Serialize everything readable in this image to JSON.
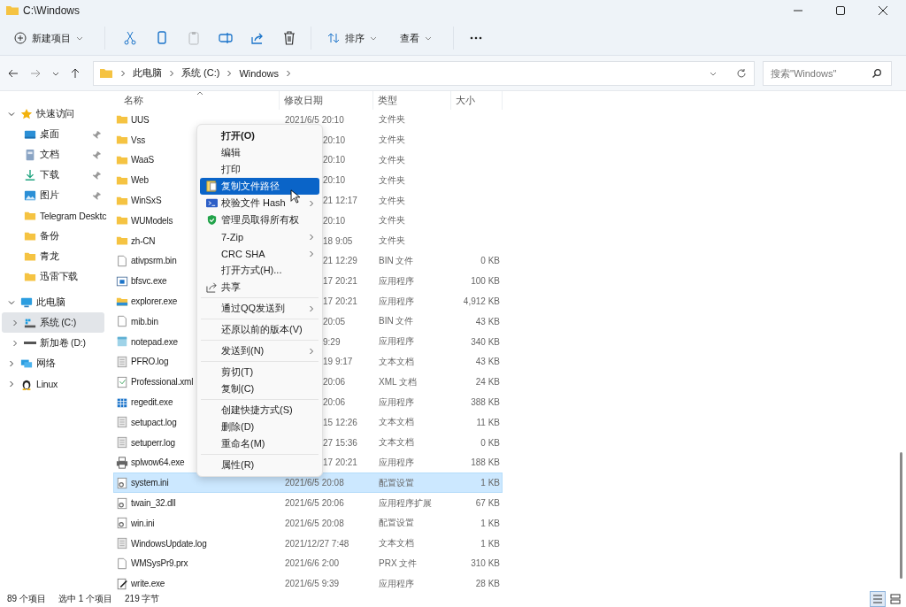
{
  "window": {
    "title": "C:\\Windows"
  },
  "toolbar": {
    "new_item": "新建项目",
    "buttons": [
      {
        "kind": "cut",
        "disabled": false
      },
      {
        "kind": "copy",
        "disabled": false
      },
      {
        "kind": "paste",
        "disabled": true
      },
      {
        "kind": "rename",
        "disabled": false
      },
      {
        "kind": "share",
        "disabled": false
      },
      {
        "kind": "delete",
        "disabled": false
      }
    ],
    "sort": "排序",
    "view": "查看"
  },
  "address": {
    "crumbs": [
      "此电脑",
      "系统 (C:)",
      "Windows"
    ],
    "search_placeholder": "搜索\"Windows\""
  },
  "nav": [
    {
      "label": "快速访问",
      "kind": "star",
      "expanded": true,
      "selected": false,
      "children": [
        {
          "label": "桌面",
          "kind": "desktop",
          "pinned": true,
          "selected": false
        },
        {
          "label": "文档",
          "kind": "documents",
          "pinned": true,
          "selected": false
        },
        {
          "label": "下载",
          "kind": "download",
          "pinned": true,
          "selected": false
        },
        {
          "label": "图片",
          "kind": "pictures",
          "pinned": true,
          "selected": false
        },
        {
          "label": "Telegram Desktc",
          "kind": "folder",
          "pinned": false,
          "selected": false
        },
        {
          "label": "备份",
          "kind": "folder",
          "pinned": false,
          "selected": false
        },
        {
          "label": "青龙",
          "kind": "folder",
          "pinned": false,
          "selected": false
        },
        {
          "label": "迅雷下载",
          "kind": "folder",
          "pinned": false,
          "selected": false
        }
      ]
    },
    {
      "label": "此电脑",
      "kind": "pc",
      "expanded": true,
      "selected": false,
      "children": [
        {
          "label": "系统 (C:)",
          "kind": "drive-c",
          "expandable": true,
          "pinned": false,
          "selected": true
        },
        {
          "label": "新加卷 (D:)",
          "kind": "drive",
          "expandable": true,
          "pinned": false,
          "selected": false
        }
      ]
    },
    {
      "label": "网络",
      "kind": "network",
      "expanded": false,
      "selected": false
    },
    {
      "label": "Linux",
      "kind": "linux",
      "expanded": false,
      "selected": false
    }
  ],
  "table": {
    "columns": [
      "名称",
      "修改日期",
      "类型",
      "大小"
    ],
    "rows": [
      {
        "kind": "folder",
        "name": "UUS",
        "date": "2021/6/5 20:10",
        "date_clipped": false,
        "type": "文件夹",
        "size": "",
        "selected": false
      },
      {
        "kind": "folder",
        "name": "Vss",
        "date": "20:10",
        "date_clipped": true,
        "type": "文件夹",
        "size": "",
        "selected": false
      },
      {
        "kind": "folder",
        "name": "WaaS",
        "date": "20:10",
        "date_clipped": true,
        "type": "文件夹",
        "size": "",
        "selected": false
      },
      {
        "kind": "folder",
        "name": "Web",
        "date": "20:10",
        "date_clipped": true,
        "type": "文件夹",
        "size": "",
        "selected": false
      },
      {
        "kind": "folder",
        "name": "WinSxS",
        "date": "21 12:17",
        "date_clipped": true,
        "type": "文件夹",
        "size": "",
        "selected": false
      },
      {
        "kind": "folder",
        "name": "WUModels",
        "date": "20:10",
        "date_clipped": true,
        "type": "文件夹",
        "size": "",
        "selected": false
      },
      {
        "kind": "folder",
        "name": "zh-CN",
        "date": "18 9:05",
        "date_clipped": true,
        "type": "文件夹",
        "size": "",
        "selected": false
      },
      {
        "kind": "doc",
        "name": "ativpsrm.bin",
        "date": "21 12:29",
        "date_clipped": true,
        "type": "BIN 文件",
        "size": "0 KB",
        "selected": false
      },
      {
        "kind": "app",
        "name": "bfsvc.exe",
        "date": "17 20:21",
        "date_clipped": true,
        "type": "应用程序",
        "size": "100 KB",
        "selected": false
      },
      {
        "kind": "explorer",
        "name": "explorer.exe",
        "date": "17 20:21",
        "date_clipped": true,
        "type": "应用程序",
        "size": "4,912 KB",
        "selected": false
      },
      {
        "kind": "doc",
        "name": "mib.bin",
        "date": "20:05",
        "date_clipped": true,
        "type": "BIN 文件",
        "size": "43 KB",
        "selected": false
      },
      {
        "kind": "notepad",
        "name": "notepad.exe",
        "date": "9:29",
        "date_clipped": true,
        "type": "应用程序",
        "size": "340 KB",
        "selected": false
      },
      {
        "kind": "text",
        "name": "PFRO.log",
        "date": "19 9:17",
        "date_clipped": true,
        "type": "文本文档",
        "size": "43 KB",
        "selected": false
      },
      {
        "kind": "xml",
        "name": "Professional.xml",
        "date": "20:06",
        "date_clipped": true,
        "type": "XML 文档",
        "size": "24 KB",
        "selected": false
      },
      {
        "kind": "regedit",
        "name": "regedit.exe",
        "date": "20:06",
        "date_clipped": true,
        "type": "应用程序",
        "size": "388 KB",
        "selected": false
      },
      {
        "kind": "text",
        "name": "setupact.log",
        "date": "15 12:26",
        "date_clipped": true,
        "type": "文本文档",
        "size": "11 KB",
        "selected": false
      },
      {
        "kind": "text",
        "name": "setuperr.log",
        "date": "27 15:36",
        "date_clipped": true,
        "type": "文本文档",
        "size": "0 KB",
        "selected": false
      },
      {
        "kind": "printer",
        "name": "splwow64.exe",
        "date": "17 20:21",
        "date_clipped": true,
        "type": "应用程序",
        "size": "188 KB",
        "selected": false
      },
      {
        "kind": "gear",
        "name": "system.ini",
        "date": "2021/6/5 20:08",
        "date_clipped": false,
        "type": "配置设置",
        "size": "1 KB",
        "selected": true
      },
      {
        "kind": "gear",
        "name": "twain_32.dll",
        "date": "2021/6/5 20:06",
        "date_clipped": false,
        "type": "应用程序扩展",
        "size": "67 KB",
        "selected": false
      },
      {
        "kind": "gear",
        "name": "win.ini",
        "date": "2021/6/5 20:08",
        "date_clipped": false,
        "type": "配置设置",
        "size": "1 KB",
        "selected": false
      },
      {
        "kind": "text",
        "name": "WindowsUpdate.log",
        "date": "2021/12/27 7:48",
        "date_clipped": false,
        "type": "文本文档",
        "size": "1 KB",
        "selected": false
      },
      {
        "kind": "doc",
        "name": "WMSysPr9.prx",
        "date": "2021/6/6 2:00",
        "date_clipped": false,
        "type": "PRX 文件",
        "size": "310 KB",
        "selected": false
      },
      {
        "kind": "write",
        "name": "write.exe",
        "date": "2021/6/5 9:39",
        "date_clipped": false,
        "type": "应用程序",
        "size": "28 KB",
        "selected": false
      }
    ]
  },
  "context_menu": [
    {
      "kind": "text",
      "label": "打开(O)",
      "bold": true,
      "selected": false,
      "submenu": false
    },
    {
      "kind": "text",
      "label": "编辑",
      "bold": false,
      "selected": false,
      "submenu": false
    },
    {
      "kind": "text",
      "label": "打印",
      "bold": false,
      "selected": false,
      "submenu": false
    },
    {
      "kind": "copy-path",
      "label": "复制文件路径",
      "bold": false,
      "selected": true,
      "submenu": false
    },
    {
      "kind": "hash",
      "label": "校验文件 Hash",
      "bold": false,
      "selected": false,
      "submenu": true
    },
    {
      "kind": "shield",
      "label": "管理员取得所有权",
      "bold": false,
      "selected": false,
      "submenu": false
    },
    {
      "kind": "text",
      "label": "7-Zip",
      "bold": false,
      "selected": false,
      "submenu": true
    },
    {
      "kind": "text",
      "label": "CRC SHA",
      "bold": false,
      "selected": false,
      "submenu": true
    },
    {
      "kind": "text",
      "label": "打开方式(H)...",
      "bold": false,
      "selected": false,
      "submenu": false
    },
    {
      "kind": "share",
      "label": "共享",
      "bold": false,
      "selected": false,
      "submenu": false
    },
    {
      "kind": "separator"
    },
    {
      "kind": "text",
      "label": "通过QQ发送到",
      "bold": false,
      "selected": false,
      "submenu": true
    },
    {
      "kind": "separator"
    },
    {
      "kind": "text",
      "label": "还原以前的版本(V)",
      "bold": false,
      "selected": false,
      "submenu": false
    },
    {
      "kind": "separator"
    },
    {
      "kind": "text",
      "label": "发送到(N)",
      "bold": false,
      "selected": false,
      "submenu": true
    },
    {
      "kind": "separator"
    },
    {
      "kind": "text",
      "label": "剪切(T)",
      "bold": false,
      "selected": false,
      "submenu": false
    },
    {
      "kind": "text",
      "label": "复制(C)",
      "bold": false,
      "selected": false,
      "submenu": false
    },
    {
      "kind": "separator"
    },
    {
      "kind": "text",
      "label": "创建快捷方式(S)",
      "bold": false,
      "selected": false,
      "submenu": false
    },
    {
      "kind": "text",
      "label": "删除(D)",
      "bold": false,
      "selected": false,
      "submenu": false
    },
    {
      "kind": "text",
      "label": "重命名(M)",
      "bold": false,
      "selected": false,
      "submenu": false
    },
    {
      "kind": "separator"
    },
    {
      "kind": "text",
      "label": "属性(R)",
      "bold": false,
      "selected": false,
      "submenu": false
    }
  ],
  "status_bar": {
    "items": [
      "89 个项目",
      "选中 1 个项目",
      "219 字节"
    ],
    "views": [
      {
        "kind": "details",
        "selected": true
      },
      {
        "kind": "tiles",
        "selected": false
      }
    ]
  }
}
